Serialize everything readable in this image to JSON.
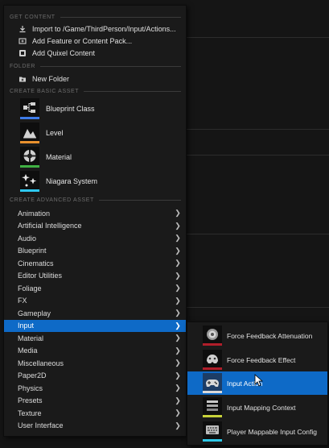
{
  "sections": {
    "get_content": "GET CONTENT",
    "folder": "FOLDER",
    "create_basic": "CREATE BASIC ASSET",
    "create_advanced": "CREATE ADVANCED ASSET"
  },
  "get_content_items": [
    {
      "label": "Import to /Game/ThirdPerson/Input/Actions...",
      "icon": "import-icon"
    },
    {
      "label": "Add Feature or Content Pack...",
      "icon": "add-feature-icon"
    },
    {
      "label": "Add Quixel Content",
      "icon": "quixel-icon"
    }
  ],
  "folder_items": [
    {
      "label": "New Folder",
      "icon": "new-folder-icon"
    }
  ],
  "basic_assets": [
    {
      "label": "Blueprint Class",
      "icon": "blueprint-class-icon",
      "color": "#3d7be8"
    },
    {
      "label": "Level",
      "icon": "level-icon",
      "color": "#e8902e"
    },
    {
      "label": "Material",
      "icon": "material-icon",
      "color": "#3fb043"
    },
    {
      "label": "Niagara System",
      "icon": "niagara-system-icon",
      "color": "#2ec8f0"
    }
  ],
  "advanced_categories": [
    "Animation",
    "Artificial Intelligence",
    "Audio",
    "Blueprint",
    "Cinematics",
    "Editor Utilities",
    "Foliage",
    "FX",
    "Gameplay",
    "Input",
    "Material",
    "Media",
    "Miscellaneous",
    "Paper2D",
    "Physics",
    "Presets",
    "Texture",
    "User Interface"
  ],
  "selected_category": "Input",
  "input_submenu": [
    {
      "label": "Force Feedback Attenuation",
      "icon": "force-feedback-attenuation-icon",
      "color": "#b01e2a"
    },
    {
      "label": "Force Feedback Effect",
      "icon": "force-feedback-effect-icon",
      "color": "#b01e2a"
    },
    {
      "label": "Input Action",
      "icon": "input-action-icon",
      "color": "#d9d9d9"
    },
    {
      "label": "Input Mapping Context",
      "icon": "input-mapping-context-icon",
      "color": "#c8d23a"
    },
    {
      "label": "Player Mappable Input Config",
      "icon": "player-mappable-input-config-icon",
      "color": "#2ec8e8"
    }
  ],
  "selected_submenu": "Input Action",
  "colors": {
    "accent": "#0e6ac7",
    "menu_bg": "#1a1a1a"
  }
}
